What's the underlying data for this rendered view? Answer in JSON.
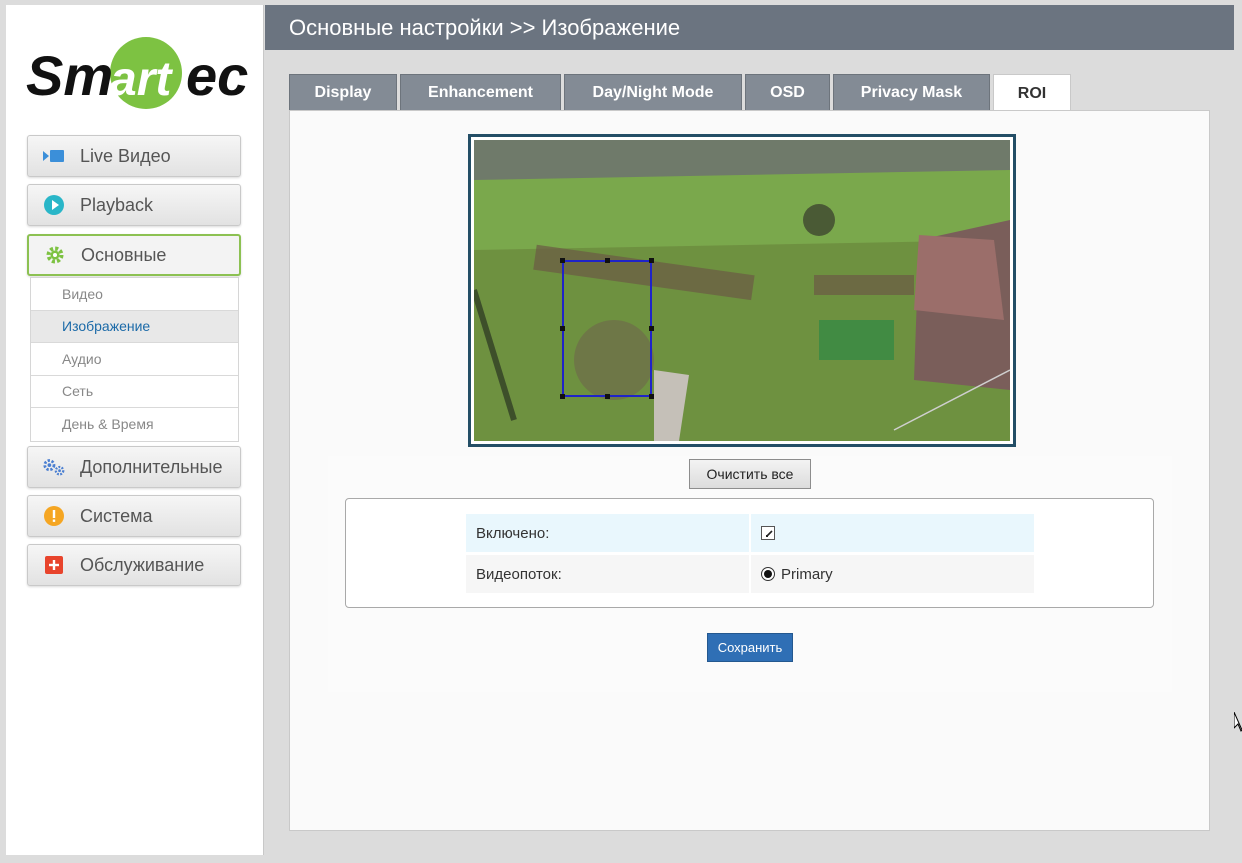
{
  "brand": {
    "logo_text_left": "Sm",
    "logo_text_mid": "art",
    "logo_text_right": "ec",
    "logo_color": "#7dc242"
  },
  "header": {
    "title": "Основные настройки >> Изображение"
  },
  "sidebar": {
    "items": [
      {
        "label": "Live Видео",
        "icon": "live-video-icon"
      },
      {
        "label": "Playback",
        "icon": "playback-icon"
      },
      {
        "label": "Основные",
        "icon": "gear-icon",
        "active": true
      },
      {
        "label": "Дополнительные",
        "icon": "gears-icon"
      },
      {
        "label": "Система",
        "icon": "warning-icon"
      },
      {
        "label": "Обслуживание",
        "icon": "plus-icon"
      }
    ],
    "submenu": [
      {
        "label": "Видео"
      },
      {
        "label": "Изображение",
        "selected": true
      },
      {
        "label": "Аудио"
      },
      {
        "label": "Сеть"
      },
      {
        "label": "День & Время"
      }
    ]
  },
  "tabs": [
    {
      "label": "Display"
    },
    {
      "label": "Enhancement"
    },
    {
      "label": "Day/Night Mode"
    },
    {
      "label": "OSD"
    },
    {
      "label": "Privacy Mask"
    },
    {
      "label": "ROI",
      "active": true
    }
  ],
  "main": {
    "clear_all_label": "Очистить все",
    "enabled_label": "Включено:",
    "enabled_checked": true,
    "stream_label": "Видеопоток:",
    "stream_value": "Primary",
    "save_label": "Сохранить"
  },
  "colors": {
    "header_bg": "#6b7480",
    "tab_bg": "#838b95",
    "active_border": "#8cc152",
    "save_button": "#2f6fb5",
    "roi_box": "#1f23c9"
  }
}
